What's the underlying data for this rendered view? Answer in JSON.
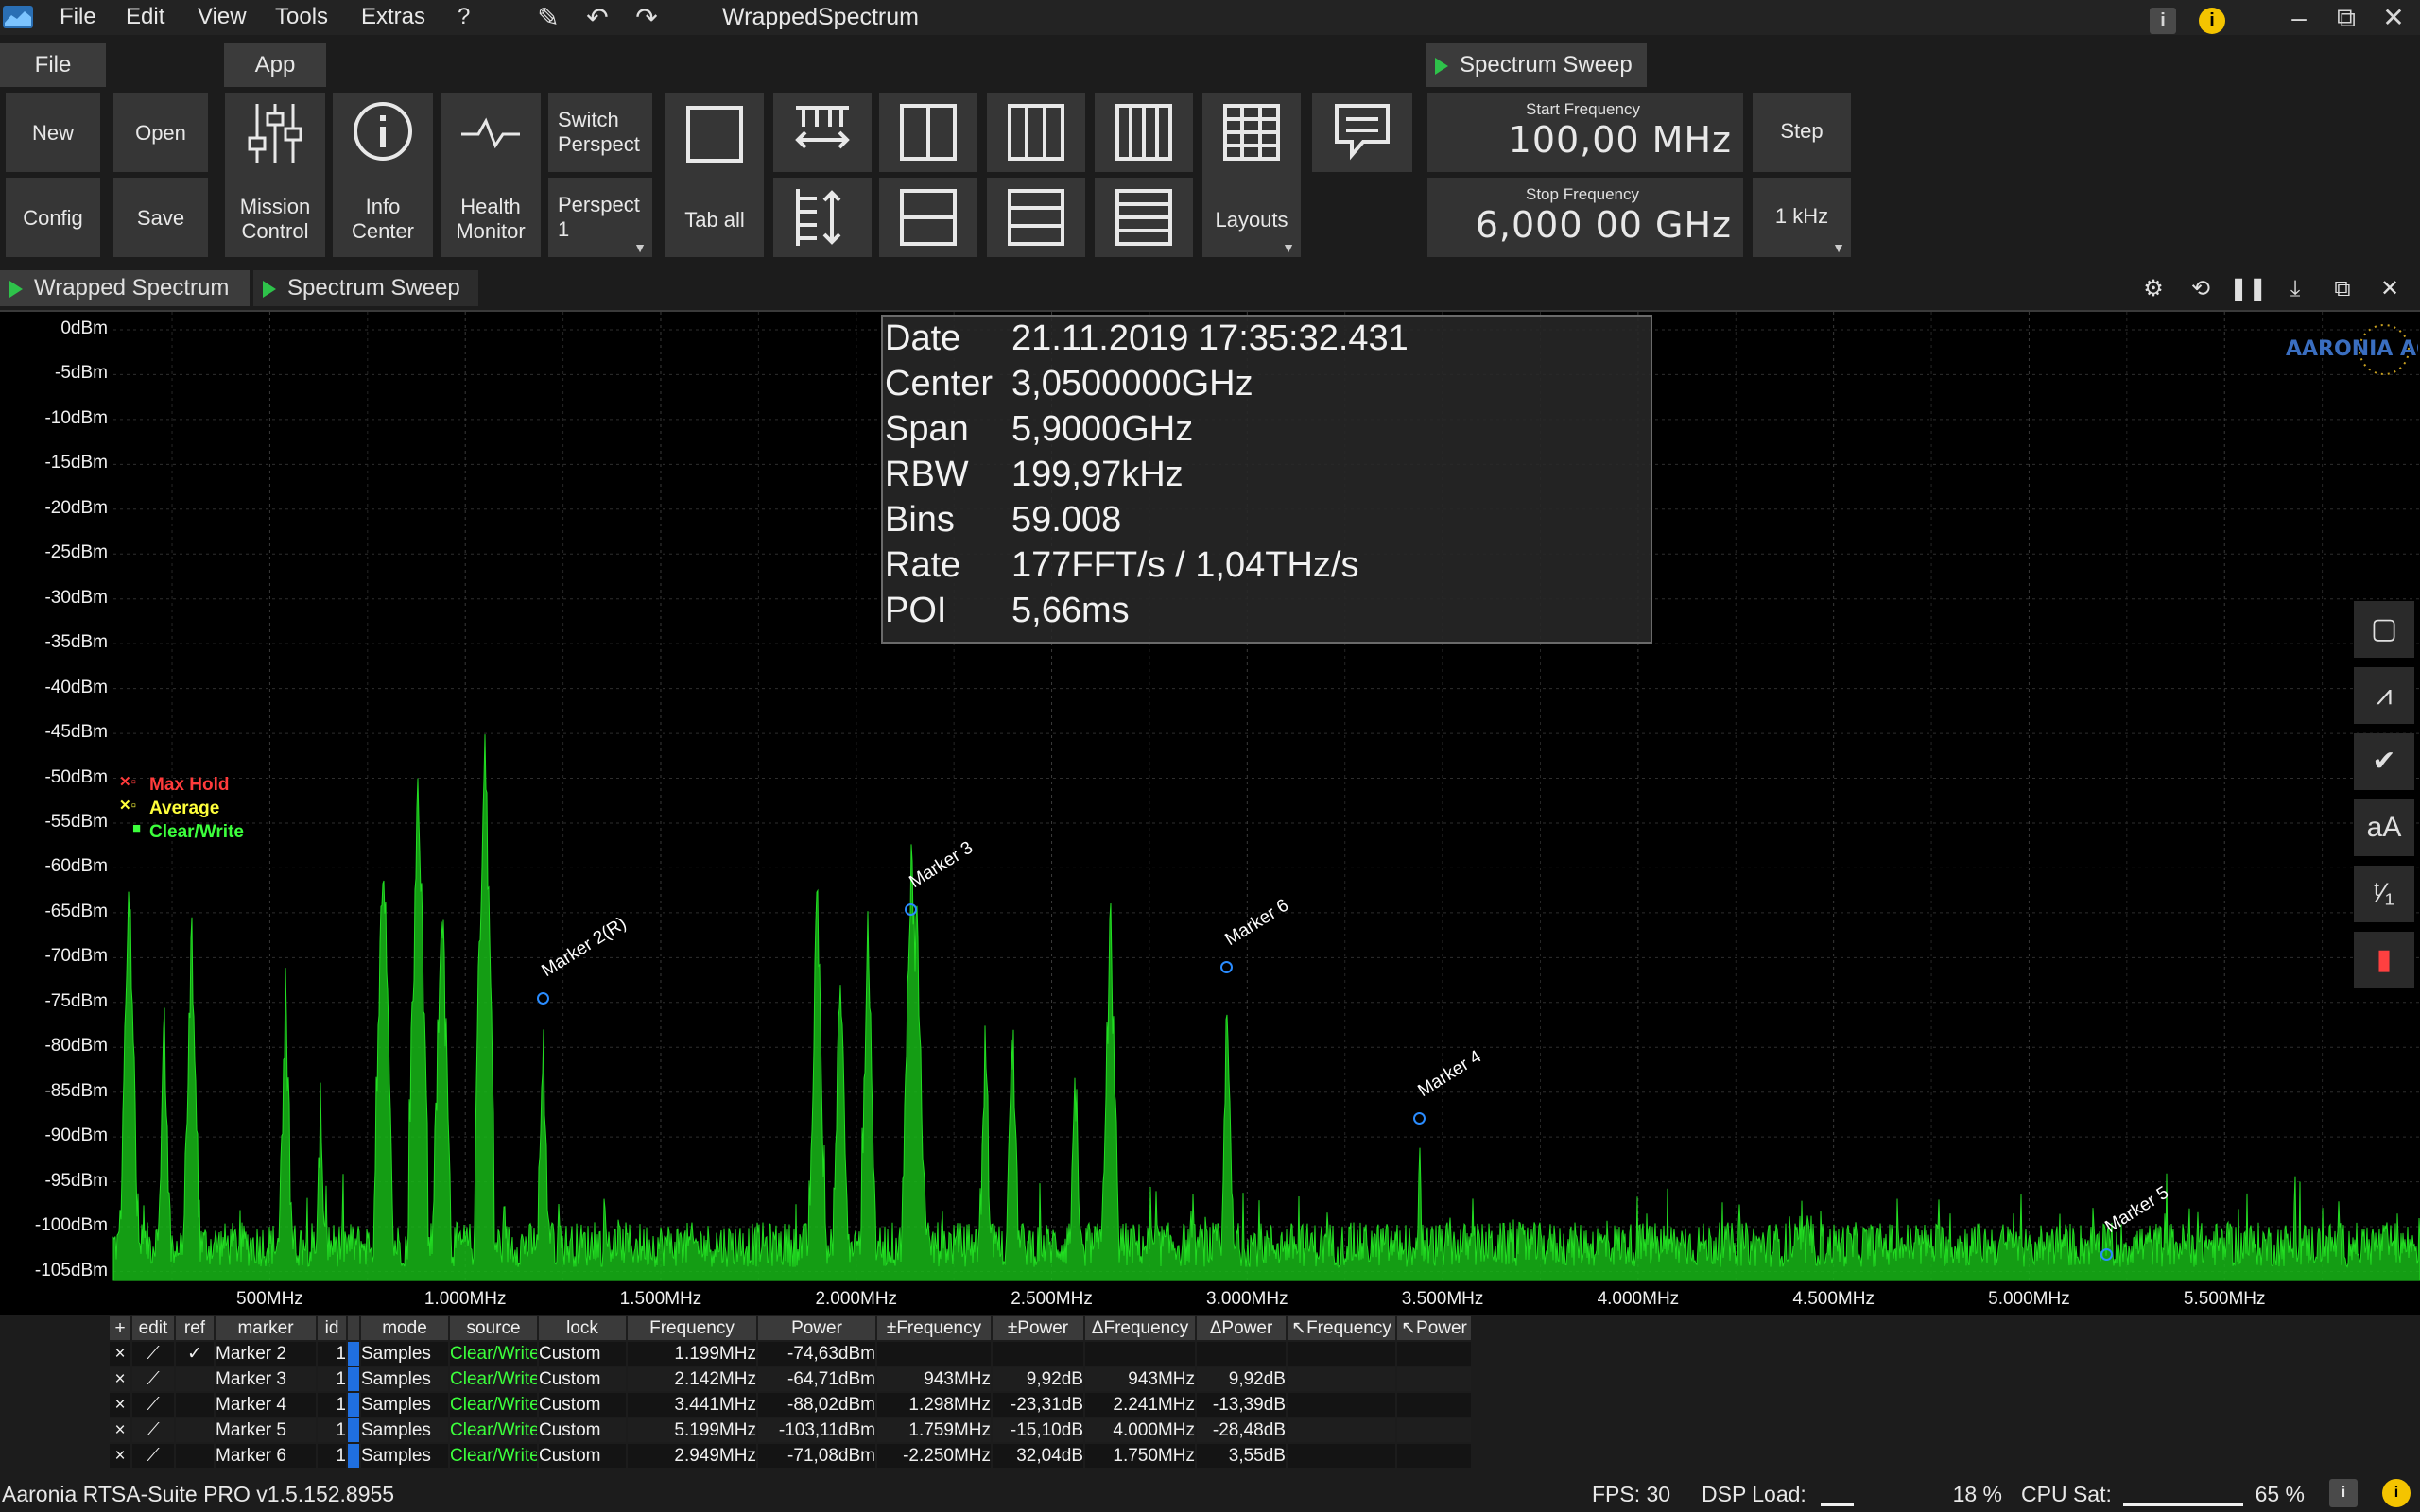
{
  "titlebar": {
    "menus": [
      "File",
      "Edit",
      "View",
      "Tools",
      "Extras",
      "?"
    ],
    "title": "WrappedSpectrum"
  },
  "ribbon_tabs": {
    "file": "File",
    "app": "App",
    "sweep": "Spectrum Sweep"
  },
  "ribbon": {
    "new": "New",
    "open": "Open",
    "config": "Config",
    "save": "Save",
    "mission_control": [
      "Mission",
      "Control"
    ],
    "info_center": [
      "Info",
      "Center"
    ],
    "health_monitor": [
      "Health",
      "Monitor"
    ],
    "switch_perspective": [
      "Switch",
      "Perspect"
    ],
    "perspective": [
      "Perspect",
      "1"
    ],
    "tab_all": "Tab all",
    "layouts": "Layouts",
    "start_frequency_label": "Start Frequency",
    "start_frequency_value": "100,00 MHz",
    "stop_frequency_label": "Stop Frequency",
    "stop_frequency_value": "6,000 00 GHz",
    "step_label": "Step",
    "step_value": "1 kHz"
  },
  "doc_tabs": [
    "Wrapped Spectrum",
    "Spectrum Sweep"
  ],
  "info": {
    "date_k": "Date",
    "date_v": "21.11.2019 17:35:32.431",
    "center_k": "Center",
    "center_v": "3,0500000GHz",
    "span_k": "Span",
    "span_v": "5,9000GHz",
    "rbw_k": "RBW",
    "rbw_v": "199,97kHz",
    "bins_k": "Bins",
    "bins_v": "59.008",
    "rate_k": "Rate",
    "rate_v": "177FFT/s / 1,04THz/s",
    "poi_k": "POI",
    "poi_v": "5,66ms"
  },
  "logo_text": "AARONIA AG",
  "legend": {
    "max_hold": "Max Hold",
    "average": "Average",
    "clear_write": "Clear/Write",
    "colors": {
      "max_hold": "#ff3b3b",
      "average": "#ffff3b",
      "clear_write": "#3cff3c"
    }
  },
  "side_tools": [
    "select-icon",
    "trace-edit-icon",
    "checklist-icon",
    "text-size-icon",
    "ratio-icon",
    "color-palette-icon"
  ],
  "side_tool_glyphs": [
    "▢",
    "⩘",
    "✔",
    "aA",
    "ᵗ⁄₁",
    "▮"
  ],
  "chart_data": {
    "type": "line",
    "ylabel_ticks": [
      "0dBm",
      "-5dBm",
      "-10dBm",
      "-15dBm",
      "-20dBm",
      "-25dBm",
      "-30dBm",
      "-35dBm",
      "-40dBm",
      "-45dBm",
      "-50dBm",
      "-55dBm",
      "-60dBm",
      "-65dBm",
      "-70dBm",
      "-75dBm",
      "-80dBm",
      "-85dBm",
      "-90dBm",
      "-95dBm",
      "-100dBm",
      "-105dBm"
    ],
    "xlabel_ticks": [
      "500MHz",
      "1.000MHz",
      "1.500MHz",
      "2.000MHz",
      "2.500MHz",
      "3.000MHz",
      "3.500MHz",
      "4.000MHz",
      "4.500MHz",
      "5.000MHz",
      "5.500MHz"
    ],
    "x_range_mhz": [
      100,
      6000
    ],
    "y_range_dbm": [
      -106,
      2
    ],
    "grid": true,
    "noise_floor_dbm": -103,
    "peaks": [
      {
        "f": 140,
        "p": -58
      },
      {
        "f": 230,
        "p": -72
      },
      {
        "f": 300,
        "p": -62
      },
      {
        "f": 540,
        "p": -70
      },
      {
        "f": 630,
        "p": -82
      },
      {
        "f": 790,
        "p": -53
      },
      {
        "f": 880,
        "p": -47
      },
      {
        "f": 940,
        "p": -58
      },
      {
        "f": 1050,
        "p": -43
      },
      {
        "f": 1199,
        "p": -74.6
      },
      {
        "f": 1900,
        "p": -60
      },
      {
        "f": 1960,
        "p": -66
      },
      {
        "f": 2030,
        "p": -64
      },
      {
        "f": 2142,
        "p": -53
      },
      {
        "f": 2155,
        "p": -60
      },
      {
        "f": 2330,
        "p": -74
      },
      {
        "f": 2400,
        "p": -74
      },
      {
        "f": 2560,
        "p": -78
      },
      {
        "f": 2650,
        "p": -62
      },
      {
        "f": 2949,
        "p": -71
      },
      {
        "f": 3441,
        "p": -88
      },
      {
        "f": 4980,
        "p": -95
      },
      {
        "f": 5199,
        "p": -101
      }
    ],
    "markers": [
      {
        "name": "Marker 2(R)",
        "f": 1199,
        "p": -74.63
      },
      {
        "name": "Marker 3",
        "f": 2142,
        "p": -64.71
      },
      {
        "name": "Marker 6",
        "f": 2949,
        "p": -71.08
      },
      {
        "name": "Marker 4",
        "f": 3441,
        "p": -88.02
      },
      {
        "name": "Marker 5",
        "f": 5199,
        "p": -103.11
      }
    ]
  },
  "marker_table": {
    "headers": [
      "+",
      "edit",
      "ref",
      "marker",
      "id",
      "",
      "mode",
      "source",
      "lock",
      "Frequency",
      "Power",
      "±Frequency",
      "±Power",
      "ΔFrequency",
      "ΔPower",
      "↖Frequency",
      "↖Power"
    ],
    "rows": [
      [
        "×",
        "⟋",
        "✓",
        "Marker 2",
        "1",
        "",
        "Samples",
        "Clear/Write",
        "Custom",
        "1.199MHz",
        "-74,63dBm",
        "",
        "",
        "",
        "",
        "",
        ""
      ],
      [
        "×",
        "⟋",
        "",
        "Marker 3",
        "1",
        "",
        "Samples",
        "Clear/Write",
        "Custom",
        "2.142MHz",
        "-64,71dBm",
        "943MHz",
        "9,92dB",
        "943MHz",
        "9,92dB",
        "",
        ""
      ],
      [
        "×",
        "⟋",
        "",
        "Marker 4",
        "1",
        "",
        "Samples",
        "Clear/Write",
        "Custom",
        "3.441MHz",
        "-88,02dBm",
        "1.298MHz",
        "-23,31dB",
        "2.241MHz",
        "-13,39dB",
        "",
        ""
      ],
      [
        "×",
        "⟋",
        "",
        "Marker 5",
        "1",
        "",
        "Samples",
        "Clear/Write",
        "Custom",
        "5.199MHz",
        "-103,11dBm",
        "1.759MHz",
        "-15,10dB",
        "4.000MHz",
        "-28,48dB",
        "",
        ""
      ],
      [
        "×",
        "⟋",
        "",
        "Marker 6",
        "1",
        "",
        "Samples",
        "Clear/Write",
        "Custom",
        "2.949MHz",
        "-71,08dBm",
        "-2.250MHz",
        "32,04dB",
        "1.750MHz",
        "3,55dB",
        "",
        ""
      ]
    ]
  },
  "statusbar": {
    "version": "Aaronia RTSA-Suite PRO v1.5.152.8955",
    "fps": "FPS: 30",
    "dsp_label": "DSP Load:",
    "dsp_value": "18 %",
    "dsp_fraction": 0.18,
    "cpu_label": "CPU Sat:",
    "cpu_value": "65 %",
    "cpu_fraction": 0.65
  },
  "colors": {
    "accent_green": "#2ec24a",
    "trace_green": "#22dd22",
    "marker_blue": "#2a8cff"
  }
}
